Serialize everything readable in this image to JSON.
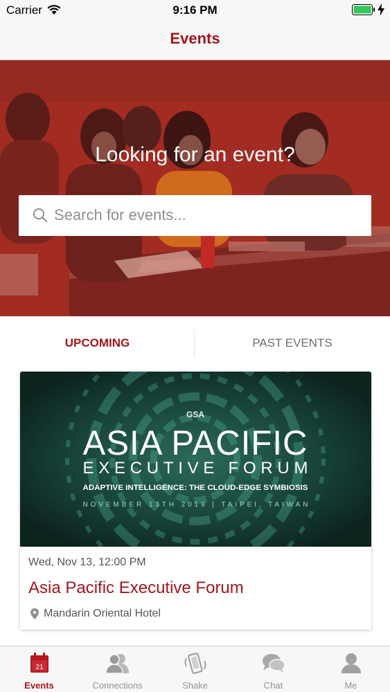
{
  "status_bar": {
    "carrier": "Carrier",
    "time": "9:16 PM"
  },
  "nav": {
    "title": "Events"
  },
  "hero": {
    "heading": "Looking for an event?",
    "search_placeholder": "Search for events..."
  },
  "tabs": [
    {
      "label": "UPCOMING",
      "active": true
    },
    {
      "label": "PAST EVENTS",
      "active": false
    }
  ],
  "event": {
    "banner": {
      "logo_text": "GSA",
      "title_line1": "ASIA PACIFIC",
      "title_line2": "EXECUTIVE FORUM",
      "subtitle": "ADAPTIVE INTELLIGENCE: THE CLOUD-EDGE SYMBIOSIS",
      "date_line": "NOVEMBER 13TH 2019 | TAIPEI, TAIWAN"
    },
    "datetime": "Wed, Nov 13, 12:00 PM",
    "title": "Asia Pacific Executive Forum",
    "location": "Mandarin Oriental Hotel"
  },
  "tab_bar": {
    "calendar_day": "21",
    "items": [
      {
        "label": "Events",
        "icon": "calendar-icon",
        "active": true
      },
      {
        "label": "Connections",
        "icon": "connections-icon",
        "active": false
      },
      {
        "label": "Shake",
        "icon": "shake-phone-icon",
        "active": false
      },
      {
        "label": "Chat",
        "icon": "chat-bubbles-icon",
        "active": false
      },
      {
        "label": "Me",
        "icon": "person-icon",
        "active": false
      }
    ]
  },
  "colors": {
    "accent": "#a3161f",
    "hero_overlay": "#a42a22",
    "banner_bg": "#0f2a24"
  }
}
